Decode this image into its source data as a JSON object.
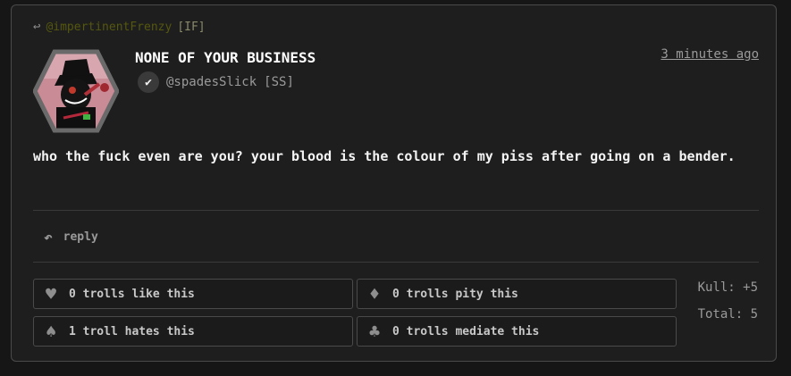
{
  "post": {
    "reply_to": {
      "handle": "@impertinentFrenzy",
      "tag": "[IF]"
    },
    "author": {
      "name": "NONE OF YOUR BUSINESS",
      "handle": "@spadesSlick",
      "tag": "[SS]"
    },
    "timestamp": "3 minutes ago",
    "body": "who the fuck even are you? your blood is the colour of my piss after going on a bender.",
    "reply_label": "reply"
  },
  "reactions": [
    {
      "icon": "heart-icon",
      "label": "0 trolls like this"
    },
    {
      "icon": "diamond-icon",
      "label": "0 trolls pity this"
    },
    {
      "icon": "spade-icon",
      "label": "1 troll hates this"
    },
    {
      "icon": "club-icon",
      "label": "0 trolls mediate this"
    }
  ],
  "stats": {
    "kull": "Kull: +5",
    "total": "Total: 5"
  },
  "colors": {
    "background": "#161616",
    "card": "#1e1e1e",
    "border": "#4a4a4a",
    "reply_handle": "#55580f"
  }
}
